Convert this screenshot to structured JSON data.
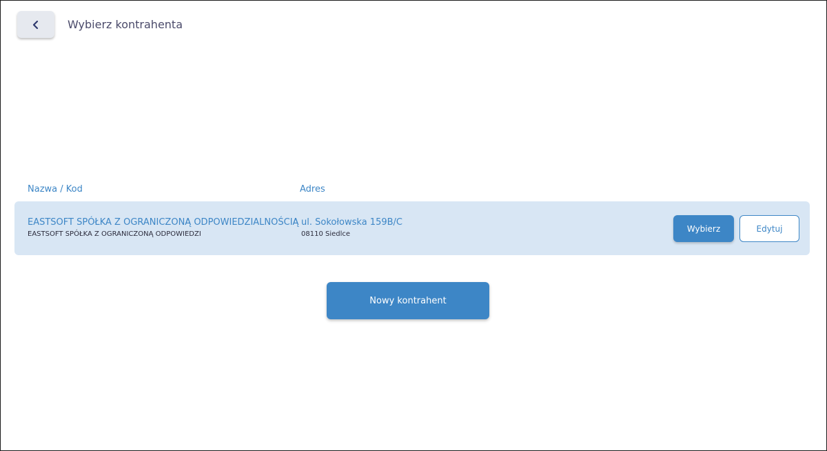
{
  "header": {
    "back_icon": "chevron-left-icon",
    "title": "Wybierz kontrahenta"
  },
  "table": {
    "columns": {
      "name": "Nazwa / Kod",
      "address": "Adres"
    },
    "rows": [
      {
        "name": "EASTSOFT SPÓŁKA Z OGRANICZONĄ ODPOWIEDZIALNOŚCIĄ",
        "code": "EASTSOFT SPÓŁKA Z OGRANICZONĄ ODPOWIEDZI",
        "street": "ul. Sokołowska 159B/C",
        "city": "08110 Siedlce",
        "select_label": "Wybierz",
        "edit_label": "Edytuj"
      }
    ]
  },
  "actions": {
    "new_label": "Nowy kontrahent"
  },
  "colors": {
    "accent": "#3d86c6",
    "row_background": "#d8e6f4",
    "back_button_background": "#e6e9ef"
  }
}
